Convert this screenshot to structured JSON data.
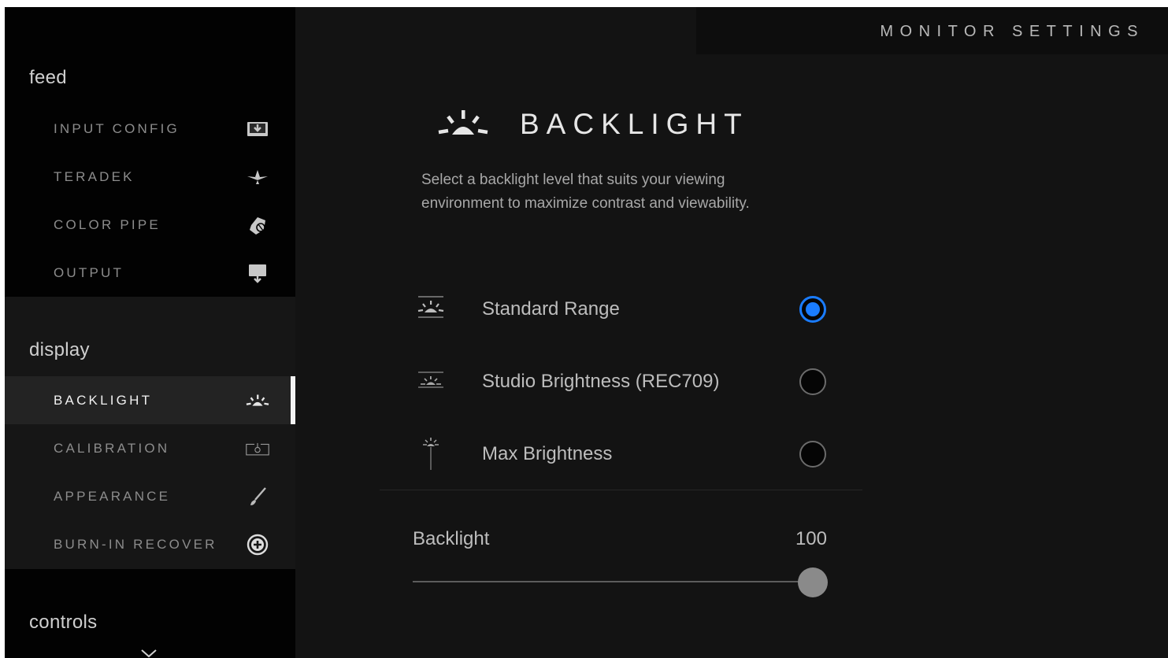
{
  "header": {
    "title": "MONITOR SETTINGS"
  },
  "sidebar": {
    "sections": {
      "feed": {
        "title": "feed",
        "items": [
          {
            "label": "INPUT CONFIG",
            "icon": "input-config-icon"
          },
          {
            "label": "TERADEK",
            "icon": "teradek-icon"
          },
          {
            "label": "COLOR PIPE",
            "icon": "color-pipe-icon"
          },
          {
            "label": "OUTPUT",
            "icon": "output-icon"
          }
        ]
      },
      "display": {
        "title": "display",
        "items": [
          {
            "label": "BACKLIGHT",
            "icon": "backlight-icon",
            "active": true
          },
          {
            "label": "CALIBRATION",
            "icon": "calibration-icon"
          },
          {
            "label": "APPEARANCE",
            "icon": "brush-icon"
          },
          {
            "label": "BURN-IN RECOVER",
            "icon": "plus-circle-icon"
          }
        ]
      },
      "controls": {
        "title": "controls",
        "icon": "chevron-down-icon"
      }
    }
  },
  "panel": {
    "title": "BACKLIGHT",
    "description": "Select a backlight level that suits your viewing environment to maximize contrast and viewability.",
    "options": [
      {
        "label": "Standard Range",
        "checked": true,
        "icon": "standard-range-icon"
      },
      {
        "label": "Studio Brightness (REC709)",
        "checked": false,
        "icon": "studio-brightness-icon"
      },
      {
        "label": "Max Brightness",
        "checked": false,
        "icon": "max-brightness-icon"
      }
    ],
    "slider": {
      "label": "Backlight",
      "value": "100",
      "min": 0,
      "max": 100
    }
  },
  "colors": {
    "accent": "#1a7cff",
    "background": "#131313",
    "sidebar_dark": "#020202"
  }
}
